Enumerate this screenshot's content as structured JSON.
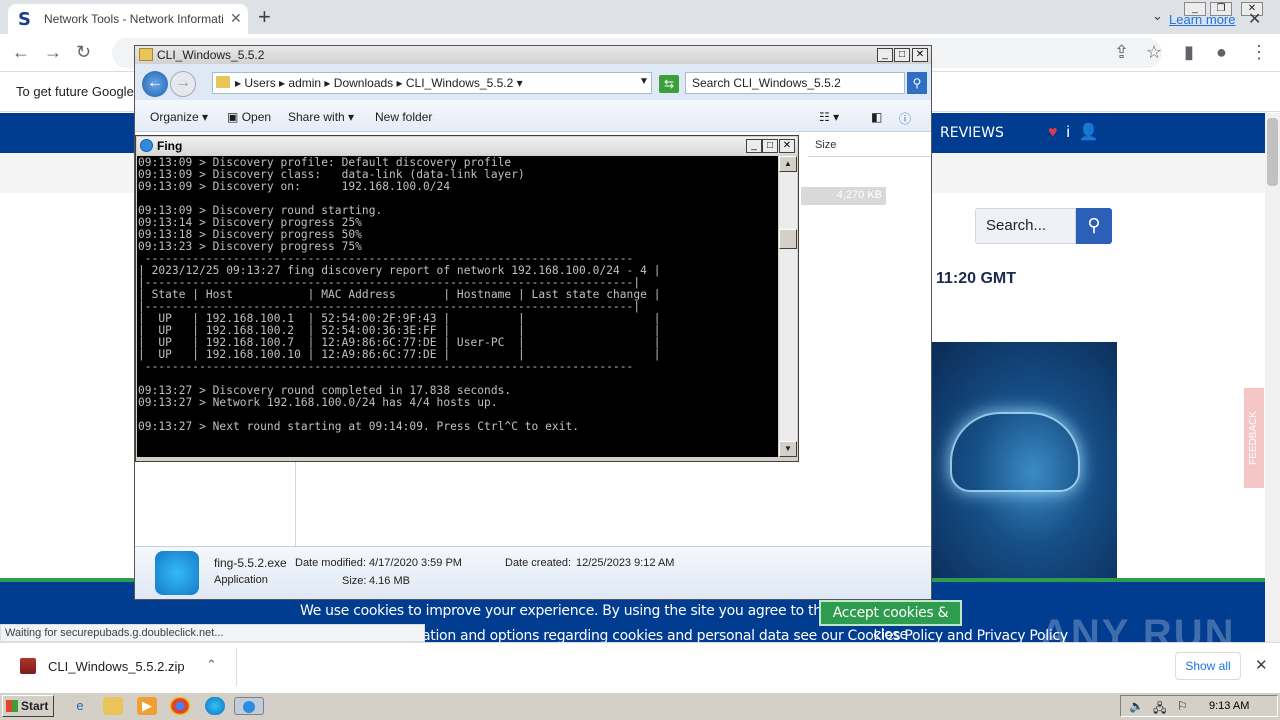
{
  "browser": {
    "tab_title": "Network Tools - Network Information",
    "tab_close": "✕",
    "new_tab": "+",
    "info_text": "To get future Google",
    "learn_more": "Learn more",
    "status_text": "Waiting for securepubads.g.doubleclick.net...",
    "download_name": "CLI_Windows_5.5.2.zip",
    "show_all": "Show all"
  },
  "website": {
    "reviews": "REVIEWS",
    "search_placeholder": "Search...",
    "time_fragment": "11:20 GMT",
    "feedback": "FEEDBACK",
    "cookie_text": "We use cookies to improve your experience. By using the site you agree to the use of cookies.",
    "cookie_button": "Accept cookies & close",
    "cookie_text2": "ation and options regarding cookies and personal data see our Cookies Policy and Privacy Policy",
    "watermark": "ANY RUN"
  },
  "explorer": {
    "title": "CLI_Windows_5.5.2",
    "breadcrumb": [
      "Users",
      "admin",
      "Downloads",
      "CLI_Windows_5.5.2"
    ],
    "search_placeholder": "Search CLI_Windows_5.5.2",
    "commands": {
      "organize": "Organize",
      "open": "Open",
      "share_with": "Share with",
      "new_folder": "New folder"
    },
    "column_size": "Size",
    "size_value": "4,270 KB",
    "details": {
      "name": "fing-5.5.2.exe",
      "type": "Application",
      "date_modified_label": "Date modified:",
      "date_modified": "4/17/2020 3:59 PM",
      "size_label": "Size:",
      "size": "4.16 MB",
      "date_created_label": "Date created:",
      "date_created": "12/25/2023 9:12 AM"
    }
  },
  "fing": {
    "title": "Fing",
    "console_lines": [
      "09:13:09 > Discovery profile: Default discovery profile",
      "09:13:09 > Discovery class:   data-link (data-link layer)",
      "09:13:09 > Discovery on:      192.168.100.0/24",
      "",
      "09:13:09 > Discovery round starting.",
      "09:13:14 > Discovery progress 25%",
      "09:13:18 > Discovery progress 50%",
      "09:13:23 > Discovery progress 75%",
      " ------------------------------------------------------------------------",
      "| 2023/12/25 09:13:27 fing discovery report of network 192.168.100.0/24 - 4 |",
      "|------------------------------------------------------------------------|",
      "| State | Host           | MAC Address       | Hostname | Last state change |",
      "|------------------------------------------------------------------------|",
      "|  UP   | 192.168.100.1  | 52:54:00:2F:9F:43 |          |                   |",
      "|  UP   | 192.168.100.2  | 52:54:00:36:3E:FF |          |                   |",
      "|  UP   | 192.168.100.7  | 12:A9:86:6C:77:DE | User-PC  |                   |",
      "|  UP   | 192.168.100.10 | 12:A9:86:6C:77:DE |          |                   |",
      " ------------------------------------------------------------------------",
      "",
      "09:13:27 > Discovery round completed in 17.838 seconds.",
      "09:13:27 > Network 192.168.100.0/24 has 4/4 hosts up.",
      "",
      "09:13:27 > Next round starting at 09:14:09. Press Ctrl^C to exit."
    ]
  },
  "taskbar": {
    "start": "Start",
    "clock": "9:13 AM"
  }
}
